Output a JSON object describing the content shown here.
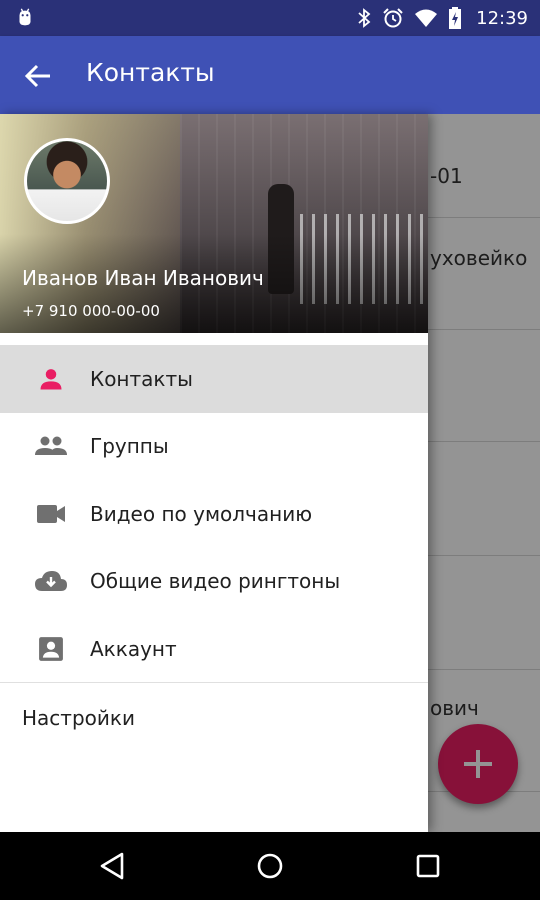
{
  "status_bar": {
    "time": "12:39",
    "icons": [
      "android-debug-icon",
      "bluetooth-icon",
      "alarm-icon",
      "wifi-icon",
      "battery-icon"
    ]
  },
  "app_bar": {
    "title": "Контакты",
    "back_icon": "arrow-left-icon"
  },
  "background": {
    "rows": [
      "-01",
      "уховейко",
      "",
      "",
      "",
      "ович"
    ]
  },
  "drawer": {
    "user_name": "Иванов Иван Иванович",
    "user_phone": "+7 910 000-00-00",
    "items": [
      {
        "label": "Контакты",
        "icon": "person-icon",
        "active": true
      },
      {
        "label": "Группы",
        "icon": "people-icon",
        "active": false
      },
      {
        "label": "Видео по умолчанию",
        "icon": "videocam-icon",
        "active": false
      },
      {
        "label": "Общие видео рингтоны",
        "icon": "cloud-download-icon",
        "active": false
      },
      {
        "label": "Аккаунт",
        "icon": "account-box-icon",
        "active": false
      }
    ],
    "settings_label": "Настройки"
  },
  "fab": {
    "icon": "plus-icon"
  },
  "nav_bar": {
    "icons": [
      "back-triangle-icon",
      "home-circle-icon",
      "recents-square-icon"
    ]
  },
  "colors": {
    "primary": "#3f51b5",
    "status": "#2a3178",
    "accent": "#e91e63"
  }
}
